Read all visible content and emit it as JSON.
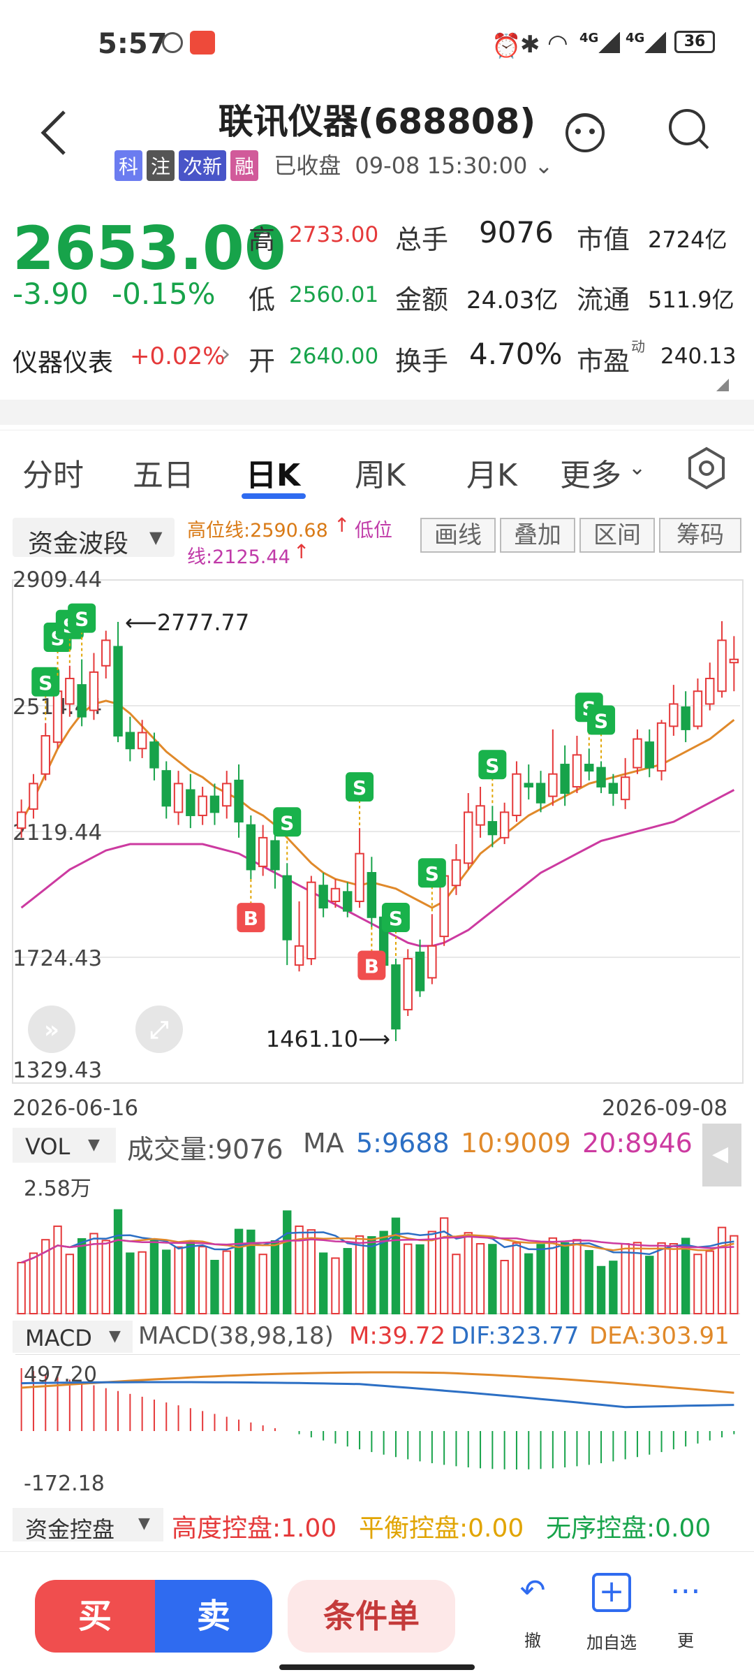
{
  "status": {
    "time": "5:57",
    "battery": "36",
    "net1": "4G",
    "net2": "4G"
  },
  "header": {
    "title": "联讯仪器(688808)",
    "tags": [
      "科",
      "注",
      "次新",
      "融"
    ],
    "status_text": "已收盘",
    "datetime": "09-08 15:30:00"
  },
  "quote": {
    "price": "2653.00",
    "change": "-3.90",
    "change_pct": "-0.15%",
    "sector": "仪器仪表",
    "sector_change": "+0.02%",
    "high_label": "高",
    "high": "2733.00",
    "low_label": "低",
    "low": "2560.01",
    "open_label": "开",
    "open": "2640.00",
    "volume_label": "总手",
    "volume": "9076",
    "amount_label": "金额",
    "amount": "24.03亿",
    "turnover_label": "换手",
    "turnover": "4.70%",
    "mktcap_label": "市值",
    "mktcap": "2724亿",
    "float_label": "流通",
    "float": "511.9亿",
    "pe_label": "市盈",
    "pe_sup": "动",
    "pe": "240.13"
  },
  "tabs": [
    "分时",
    "五日",
    "日K",
    "周K",
    "月K",
    "更多"
  ],
  "toolbar": {
    "indicator": "资金波段",
    "high_line": "高位线:2590.68",
    "low_line_a": "低位",
    "low_line_b": "线:2125.44",
    "buttons": [
      "画线",
      "叠加",
      "区间",
      "筹码"
    ]
  },
  "colors": {
    "up": "#e5393a",
    "down": "#17a34a",
    "ma5": "#e0892a",
    "ma20": "#cc3aa0",
    "accent": "#1a5fd6"
  },
  "chart_data": {
    "type": "candlestick",
    "y_ticks": [
      "2909.44",
      "2514.44",
      "2119.44",
      "1724.43",
      "1329.43"
    ],
    "ylim": [
      1329.43,
      2909.44
    ],
    "x_start": "2026-06-16",
    "x_end": "2026-09-08",
    "annot_high": "2777.77",
    "annot_low": "1461.10",
    "sell_markers": [
      2,
      3,
      4,
      5,
      22,
      28,
      31,
      34,
      39,
      47,
      48
    ],
    "buy_markers": [
      19,
      29
    ],
    "candles": [
      [
        2130,
        2180,
        2100,
        2220
      ],
      [
        2190,
        2270,
        2160,
        2300
      ],
      [
        2300,
        2420,
        2280,
        2460
      ],
      [
        2400,
        2560,
        2380,
        2600
      ],
      [
        2520,
        2600,
        2480,
        2640
      ],
      [
        2580,
        2480,
        2450,
        2660
      ],
      [
        2500,
        2620,
        2470,
        2680
      ],
      [
        2640,
        2720,
        2600,
        2750
      ],
      [
        2700,
        2420,
        2400,
        2777.77
      ],
      [
        2430,
        2380,
        2340,
        2480
      ],
      [
        2380,
        2430,
        2350,
        2470
      ],
      [
        2400,
        2320,
        2280,
        2430
      ],
      [
        2310,
        2200,
        2160,
        2340
      ],
      [
        2180,
        2270,
        2140,
        2310
      ],
      [
        2250,
        2170,
        2130,
        2300
      ],
      [
        2170,
        2230,
        2140,
        2260
      ],
      [
        2230,
        2180,
        2140,
        2270
      ],
      [
        2200,
        2270,
        2160,
        2310
      ],
      [
        2280,
        2150,
        2100,
        2330
      ],
      [
        2140,
        2000,
        1970,
        2170
      ],
      [
        2010,
        2100,
        1980,
        2140
      ],
      [
        2090,
        2000,
        1940,
        2140
      ],
      [
        1980,
        1780,
        1700,
        2020
      ],
      [
        1700,
        1760,
        1680,
        1900
      ],
      [
        1720,
        1960,
        1700,
        1980
      ],
      [
        1950,
        1880,
        1850,
        1990
      ],
      [
        1900,
        1940,
        1880,
        1970
      ],
      [
        1930,
        1870,
        1850,
        1960
      ],
      [
        1900,
        2050,
        1880,
        2130
      ],
      [
        1990,
        1850,
        1820,
        2040
      ],
      [
        1850,
        1700,
        1660,
        1880
      ],
      [
        1700,
        1500,
        1461.1,
        1720
      ],
      [
        1560,
        1720,
        1540,
        1750
      ],
      [
        1740,
        1620,
        1600,
        1780
      ],
      [
        1660,
        1760,
        1640,
        1860
      ],
      [
        1790,
        1980,
        1760,
        2020
      ],
      [
        1950,
        2030,
        1920,
        2080
      ],
      [
        2020,
        2180,
        2000,
        2240
      ],
      [
        2140,
        2200,
        2100,
        2260
      ],
      [
        2150,
        2110,
        2070,
        2200
      ],
      [
        2100,
        2180,
        2080,
        2210
      ],
      [
        2170,
        2300,
        2150,
        2340
      ],
      [
        2270,
        2260,
        2220,
        2330
      ],
      [
        2270,
        2210,
        2180,
        2310
      ],
      [
        2230,
        2300,
        2200,
        2440
      ],
      [
        2330,
        2240,
        2200,
        2390
      ],
      [
        2260,
        2360,
        2240,
        2420
      ],
      [
        2330,
        2310,
        2280,
        2380
      ],
      [
        2320,
        2260,
        2240,
        2340
      ],
      [
        2270,
        2240,
        2200,
        2300
      ],
      [
        2220,
        2290,
        2190,
        2350
      ],
      [
        2320,
        2410,
        2300,
        2440
      ],
      [
        2400,
        2320,
        2290,
        2440
      ],
      [
        2310,
        2460,
        2280,
        2470
      ],
      [
        2450,
        2520,
        2420,
        2580
      ],
      [
        2510,
        2440,
        2400,
        2560
      ],
      [
        2450,
        2560,
        2440,
        2600
      ],
      [
        2520,
        2600,
        2500,
        2650
      ],
      [
        2560,
        2720,
        2540,
        2780
      ],
      [
        2650,
        2660,
        2560,
        2733
      ]
    ],
    "ma5": [
      2150,
      2220,
      2300,
      2380,
      2440,
      2490,
      2520,
      2530,
      2520,
      2490,
      2450,
      2410,
      2370,
      2340,
      2310,
      2290,
      2260,
      2240,
      2220,
      2190,
      2170,
      2140,
      2100,
      2060,
      2020,
      1990,
      1970,
      1960,
      1950,
      1960,
      1950,
      1940,
      1920,
      1900,
      1880,
      1900,
      1950,
      2000,
      2050,
      2080,
      2110,
      2140,
      2170,
      2190,
      2210,
      2230,
      2250,
      2270,
      2280,
      2290,
      2300,
      2310,
      2320,
      2330,
      2350,
      2370,
      2390,
      2410,
      2440,
      2470
    ],
    "ma20": [
      1880,
      1910,
      1940,
      1970,
      2000,
      2020,
      2040,
      2060,
      2070,
      2080,
      2080,
      2080,
      2080,
      2080,
      2080,
      2080,
      2070,
      2060,
      2050,
      2030,
      2010,
      1990,
      1970,
      1950,
      1930,
      1910,
      1890,
      1870,
      1850,
      1830,
      1810,
      1790,
      1770,
      1760,
      1760,
      1770,
      1790,
      1810,
      1840,
      1870,
      1900,
      1930,
      1960,
      1990,
      2010,
      2030,
      2050,
      2070,
      2090,
      2100,
      2110,
      2120,
      2130,
      2140,
      2150,
      2170,
      2190,
      2210,
      2230,
      2250
    ]
  },
  "vol": {
    "label": "VOL",
    "title": "成交量:9076",
    "ma_label": "MA",
    "ma5": "5:9688",
    "ma10": "10:9009",
    "ma20": "20:8946",
    "y_max": "2.58万"
  },
  "macd": {
    "label": "MACD",
    "params": "MACD(38,98,18)",
    "m": "M:39.72",
    "dif": "DIF:323.77",
    "dea": "DEA:303.91",
    "y_top": "497.20",
    "y_bot": "-172.18"
  },
  "control": {
    "label": "资金控盘",
    "high": "高度控盘:1.00",
    "balance": "平衡控盘:0.00",
    "disorder": "无序控盘:0.00"
  },
  "bottom": {
    "buy": "买",
    "sell": "卖",
    "cond": "条件单",
    "undo": "撤",
    "add": "加自选",
    "more": "更"
  }
}
